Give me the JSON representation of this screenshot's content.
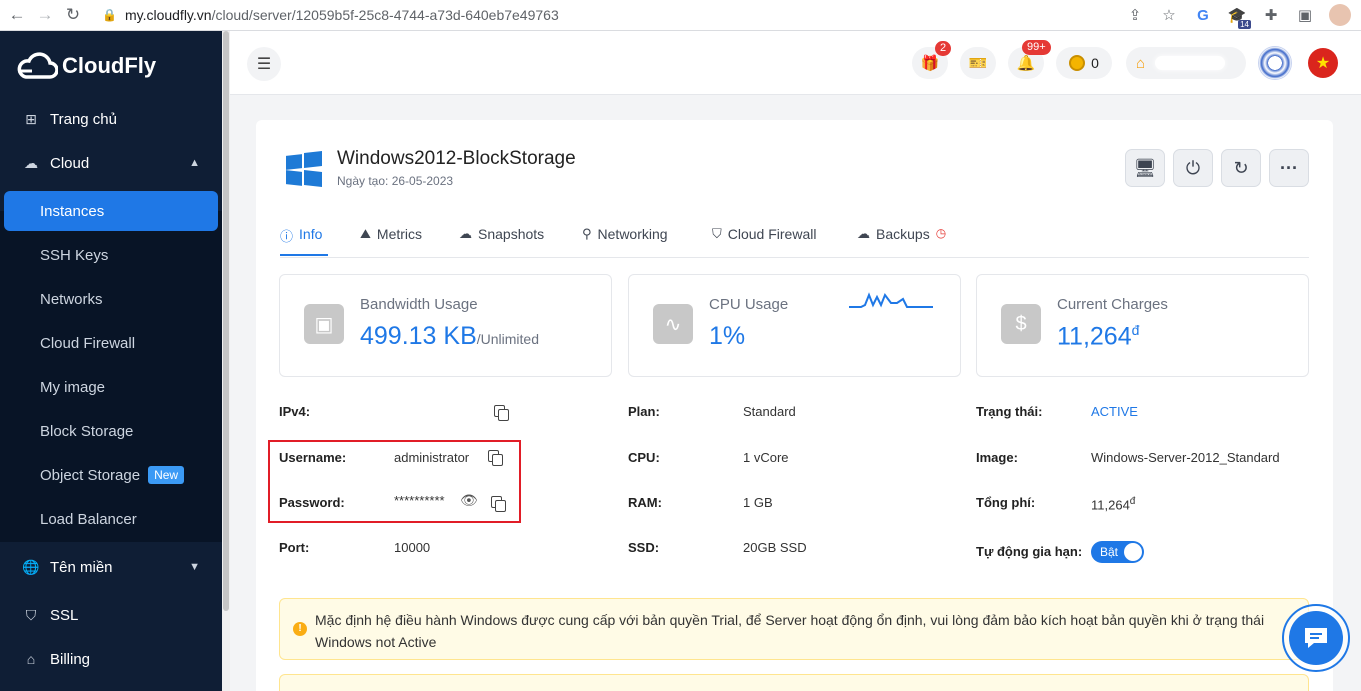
{
  "browser": {
    "url_host": "my.cloudfly.vn",
    "url_path": "/cloud/server/12059b5f-25c8-4744-a73d-640eb7e49763",
    "ext_badge": "14"
  },
  "sidebar": {
    "brand": "CloudFly",
    "items": {
      "home": "Trang chủ",
      "cloud": "Cloud",
      "domain": "Tên miền",
      "ssl": "SSL",
      "billing": "Billing"
    },
    "cloud_sub": [
      {
        "label": "Instances"
      },
      {
        "label": "SSH Keys"
      },
      {
        "label": "Networks"
      },
      {
        "label": "Cloud Firewall"
      },
      {
        "label": "My image"
      },
      {
        "label": "Block Storage"
      },
      {
        "label": "Object Storage"
      },
      {
        "label": "Load Balancer"
      }
    ],
    "new_badge": "New"
  },
  "header": {
    "gift_badge": "2",
    "bell_badge": "99+",
    "coins": "0"
  },
  "server": {
    "name": "Windows2012-BlockStorage",
    "created": "Ngày tạo: 26-05-2023"
  },
  "tabs": {
    "info": "Info",
    "metrics": "Metrics",
    "snapshots": "Snapshots",
    "networking": "Networking",
    "firewall": "Cloud Firewall",
    "backups": "Backups"
  },
  "stats": {
    "bandwidth": {
      "label": "Bandwidth Usage",
      "value": "499.13 KB",
      "suffix": "/Unlimited"
    },
    "cpu": {
      "label": "CPU Usage",
      "value": "1%"
    },
    "charges": {
      "label": "Current Charges",
      "value": "11,264",
      "currency": "đ"
    }
  },
  "details": {
    "ipv4_label": "IPv4:",
    "username_label": "Username:",
    "username_value": "administrator",
    "password_label": "Password:",
    "password_value": "**********",
    "port_label": "Port:",
    "port_value": "10000",
    "plan_label": "Plan:",
    "plan_value": "Standard",
    "cpu_label": "CPU:",
    "cpu_value": "1 vCore",
    "ram_label": "RAM:",
    "ram_value": "1 GB",
    "ssd_label": "SSD:",
    "ssd_value": "20GB SSD",
    "status_label": "Trạng thái:",
    "status_value": "ACTIVE",
    "image_label": "Image:",
    "image_value": "Windows-Server-2012_Standard",
    "total_label": "Tổng phí:",
    "total_value": "11,264",
    "total_currency": "đ",
    "autorenew_label": "Tự động gia hạn:",
    "autorenew_value": "Bật"
  },
  "notice": {
    "text": "Mặc định hệ điều hành Windows được cung cấp với bản quyền Trial, để Server hoạt động ổn định, vui lòng đảm bảo kích hoạt bản quyền khi ở trạng thái Windows not Active"
  }
}
